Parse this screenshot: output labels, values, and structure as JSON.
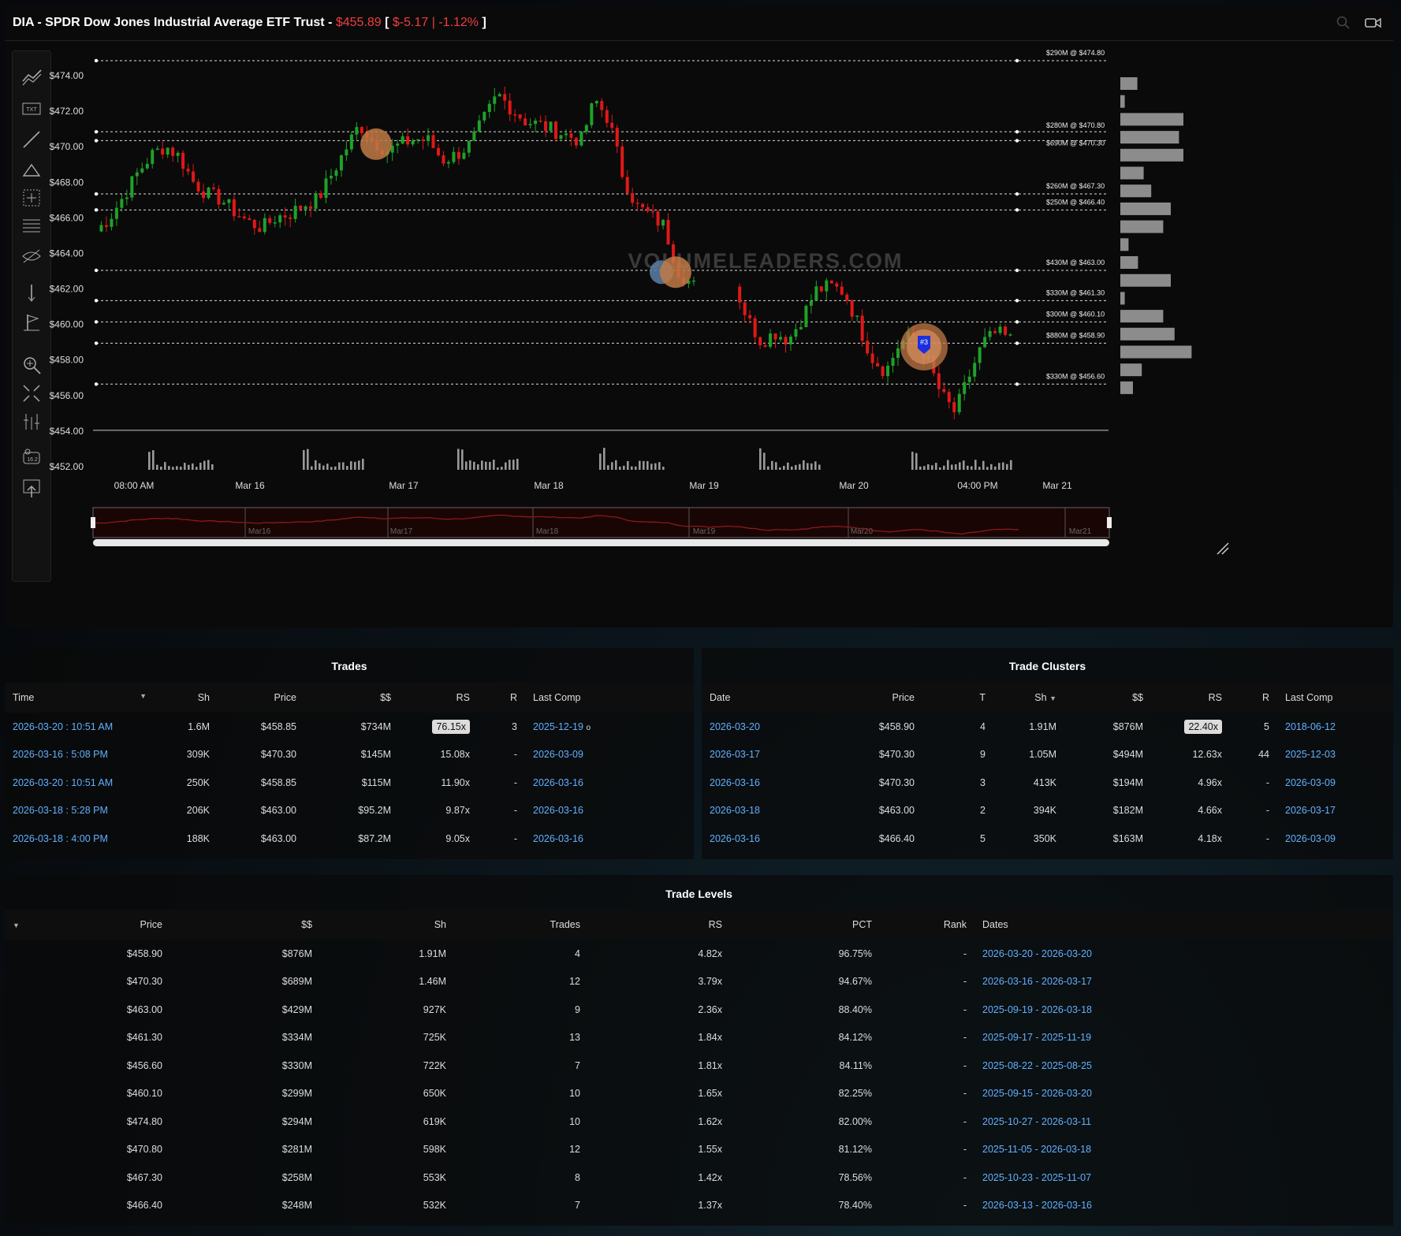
{
  "header": {
    "ticker_title": "DIA - SPDR Dow Jones Industrial Average ETF Trust - ",
    "price": "$455.89",
    "change_open": " [ ",
    "change": "$-5.17 | -1.12%",
    "change_close": " ]",
    "icons": [
      "zoom-icon",
      "video-icon"
    ]
  },
  "toolbar": {
    "tools": [
      "trend-line-icon",
      "text-tool-icon",
      "line-tool-icon",
      "triangle-tool-icon",
      "crosshair-box-icon",
      "fib-lines-icon",
      "hide-eye-icon",
      "ruler-icon",
      "flag-icon",
      "zoom-in-icon",
      "fit-screen-icon",
      "indicators-icon",
      "price-label-icon",
      "screenshot-icon"
    ]
  },
  "chart": {
    "watermark": "VOLUMELEADERS.COM",
    "y_ticks": [
      "$474.00",
      "$472.00",
      "$470.00",
      "$468.00",
      "$466.00",
      "$464.00",
      "$462.00",
      "$460.00",
      "$458.00",
      "$456.00",
      "$454.00",
      "$452.00"
    ],
    "x_ticks": [
      "08:00 AM",
      "Mar 16",
      "Mar 17",
      "Mar 18",
      "Mar 19",
      "Mar 20",
      "04:00 PM",
      "Mar 21"
    ],
    "nav_ticks": [
      "Mar16",
      "Mar17",
      "Mar18",
      "Mar19",
      "Mar20",
      "Mar21"
    ],
    "level_labels": [
      "$290M @ $474.80",
      "$280M @ $470.80",
      "$690M @ $470.30",
      "$260M @ $467.30",
      "$250M @ $466.40",
      "$430M @ $463.00",
      "$330M @ $461.30",
      "$300M @ $460.10",
      "$880M @ $458.90",
      "$330M @ $456.60"
    ],
    "marker_label": "#3",
    "colors": {
      "up": "#1fa12a",
      "down": "#e01818",
      "cluster": "#c07a45"
    }
  },
  "chart_data": {
    "type": "candlestick",
    "xlabel": "",
    "ylabel": "",
    "ylim": [
      452,
      475
    ],
    "x_ticks": [
      "08:00 AM",
      "Mar 16",
      "Mar 17",
      "Mar 18",
      "Mar 19",
      "Mar 20",
      "04:00 PM",
      "Mar 21"
    ],
    "close_path": [
      465.2,
      466.0,
      467.2,
      468.5,
      469.5,
      470.0,
      469.4,
      468.0,
      467.3,
      467.0,
      466.3,
      465.7,
      465.4,
      466.0,
      466.2,
      466.7,
      467.0,
      468.4,
      469.8,
      471.2,
      470.3,
      469.7,
      470.1,
      470.4,
      470.3,
      469.2,
      469.5,
      470.1,
      471.5,
      472.9,
      472.1,
      471.4,
      471.2,
      470.9,
      470.6,
      470.3,
      472.6,
      471.5,
      468.4,
      466.6,
      466.1,
      465.5,
      463.0,
      462.2,
      461.7,
      462.6,
      462.4,
      460.3,
      459.0,
      459.5,
      459.1,
      460.4,
      461.9,
      462.1,
      461.8,
      460.0,
      458.1,
      457.3,
      458.9,
      459.3,
      458.0,
      456.0,
      455.0,
      457.0,
      458.9,
      459.5,
      459.1
    ],
    "trade_levels_on_chart": [
      {
        "dollars": "$290M",
        "price": 474.8
      },
      {
        "dollars": "$280M",
        "price": 470.8
      },
      {
        "dollars": "$690M",
        "price": 470.3
      },
      {
        "dollars": "$260M",
        "price": 467.3
      },
      {
        "dollars": "$250M",
        "price": 466.4
      },
      {
        "dollars": "$430M",
        "price": 463.0
      },
      {
        "dollars": "$330M",
        "price": 461.3
      },
      {
        "dollars": "$300M",
        "price": 460.1
      },
      {
        "dollars": "$880M",
        "price": 458.9
      },
      {
        "dollars": "$330M",
        "price": 456.6
      }
    ],
    "volume_profile_relative": [
      0.27,
      0.07,
      1.0,
      0.93,
      1.0,
      0.37,
      0.49,
      0.8,
      0.68,
      0.13,
      0.28,
      0.8,
      0.07,
      0.68,
      0.86,
      1.13,
      0.34,
      0.2
    ]
  },
  "trades": {
    "title": "Trades",
    "columns": [
      "Time",
      "Sh",
      "Price",
      "$$",
      "RS",
      "R",
      "Last Comp"
    ],
    "rows": [
      {
        "time": "2026-03-20 : 10:51 AM",
        "sh": "1.6M",
        "price": "$458.85",
        "dollars": "$734M",
        "rs": "76.15x",
        "r": "3",
        "last": "2025-12-19",
        "note": "o"
      },
      {
        "time": "2026-03-16 : 5:08 PM",
        "sh": "309K",
        "price": "$470.30",
        "dollars": "$145M",
        "rs": "15.08x",
        "r": "-",
        "last": "2026-03-09",
        "note": ""
      },
      {
        "time": "2026-03-20 : 10:51 AM",
        "sh": "250K",
        "price": "$458.85",
        "dollars": "$115M",
        "rs": "11.90x",
        "r": "-",
        "last": "2026-03-16",
        "note": ""
      },
      {
        "time": "2026-03-18 : 5:28 PM",
        "sh": "206K",
        "price": "$463.00",
        "dollars": "$95.2M",
        "rs": "9.87x",
        "r": "-",
        "last": "2026-03-16",
        "note": ""
      },
      {
        "time": "2026-03-18 : 4:00 PM",
        "sh": "188K",
        "price": "$463.00",
        "dollars": "$87.2M",
        "rs": "9.05x",
        "r": "-",
        "last": "2026-03-16",
        "note": ""
      }
    ]
  },
  "clusters": {
    "title": "Trade Clusters",
    "columns": [
      "Date",
      "Price",
      "T",
      "Sh",
      "$$",
      "RS",
      "R",
      "Last Comp"
    ],
    "rows": [
      {
        "date": "2026-03-20",
        "price": "$458.90",
        "t": "4",
        "sh": "1.91M",
        "dollars": "$876M",
        "rs": "22.40x",
        "r": "5",
        "last": "2018-06-12"
      },
      {
        "date": "2026-03-17",
        "price": "$470.30",
        "t": "9",
        "sh": "1.05M",
        "dollars": "$494M",
        "rs": "12.63x",
        "r": "44",
        "last": "2025-12-03"
      },
      {
        "date": "2026-03-16",
        "price": "$470.30",
        "t": "3",
        "sh": "413K",
        "dollars": "$194M",
        "rs": "4.96x",
        "r": "-",
        "last": "2026-03-09"
      },
      {
        "date": "2026-03-18",
        "price": "$463.00",
        "t": "2",
        "sh": "394K",
        "dollars": "$182M",
        "rs": "4.66x",
        "r": "-",
        "last": "2026-03-17"
      },
      {
        "date": "2026-03-16",
        "price": "$466.40",
        "t": "5",
        "sh": "350K",
        "dollars": "$163M",
        "rs": "4.18x",
        "r": "-",
        "last": "2026-03-09"
      }
    ]
  },
  "levels": {
    "title": "Trade Levels",
    "columns": [
      "Price",
      "$$",
      "Sh",
      "Trades",
      "RS",
      "PCT",
      "Rank",
      "Dates"
    ],
    "rows": [
      {
        "price": "$458.90",
        "dollars": "$876M",
        "sh": "1.91M",
        "trades": "4",
        "rs": "4.82x",
        "pct": "96.75%",
        "rank": "-",
        "dates": "2026-03-20 - 2026-03-20"
      },
      {
        "price": "$470.30",
        "dollars": "$689M",
        "sh": "1.46M",
        "trades": "12",
        "rs": "3.79x",
        "pct": "94.67%",
        "rank": "-",
        "dates": "2026-03-16 - 2026-03-17"
      },
      {
        "price": "$463.00",
        "dollars": "$429M",
        "sh": "927K",
        "trades": "9",
        "rs": "2.36x",
        "pct": "88.40%",
        "rank": "-",
        "dates": "2025-09-19 - 2026-03-18"
      },
      {
        "price": "$461.30",
        "dollars": "$334M",
        "sh": "725K",
        "trades": "13",
        "rs": "1.84x",
        "pct": "84.12%",
        "rank": "-",
        "dates": "2025-09-17 - 2025-11-19"
      },
      {
        "price": "$456.60",
        "dollars": "$330M",
        "sh": "722K",
        "trades": "7",
        "rs": "1.81x",
        "pct": "84.11%",
        "rank": "-",
        "dates": "2025-08-22 - 2025-08-25"
      },
      {
        "price": "$460.10",
        "dollars": "$299M",
        "sh": "650K",
        "trades": "10",
        "rs": "1.65x",
        "pct": "82.25%",
        "rank": "-",
        "dates": "2025-09-15 - 2026-03-20"
      },
      {
        "price": "$474.80",
        "dollars": "$294M",
        "sh": "619K",
        "trades": "10",
        "rs": "1.62x",
        "pct": "82.00%",
        "rank": "-",
        "dates": "2025-10-27 - 2026-03-11"
      },
      {
        "price": "$470.80",
        "dollars": "$281M",
        "sh": "598K",
        "trades": "12",
        "rs": "1.55x",
        "pct": "81.12%",
        "rank": "-",
        "dates": "2025-11-05 - 2026-03-18"
      },
      {
        "price": "$467.30",
        "dollars": "$258M",
        "sh": "553K",
        "trades": "8",
        "rs": "1.42x",
        "pct": "78.56%",
        "rank": "-",
        "dates": "2025-10-23 - 2025-11-07"
      },
      {
        "price": "$466.40",
        "dollars": "$248M",
        "sh": "532K",
        "trades": "7",
        "rs": "1.37x",
        "pct": "78.40%",
        "rank": "-",
        "dates": "2026-03-13 - 2026-03-16"
      }
    ]
  }
}
